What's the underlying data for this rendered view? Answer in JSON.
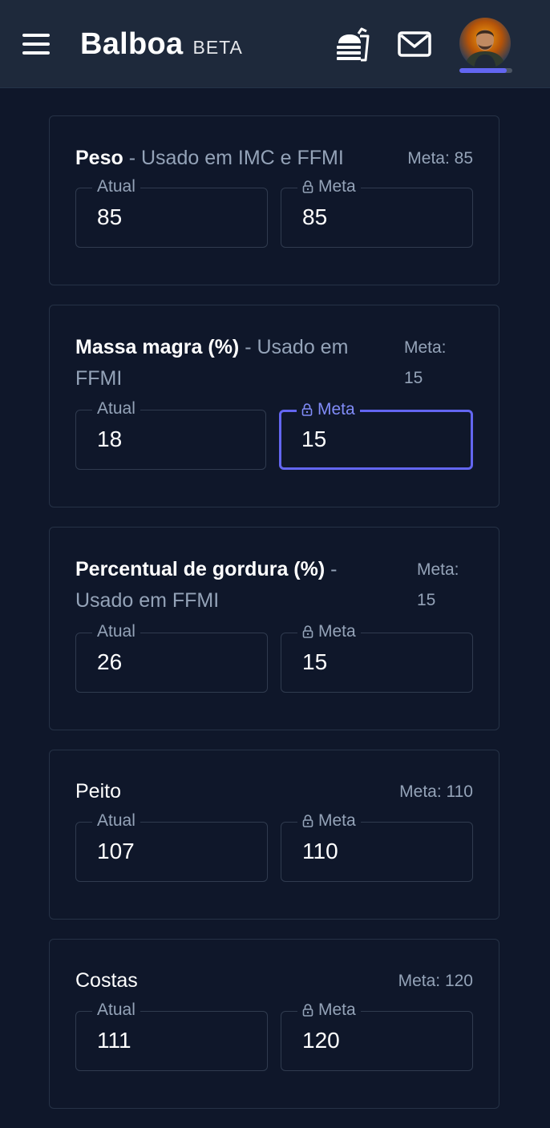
{
  "header": {
    "brand": "Balboa",
    "badge": "BETA",
    "menu_icon": "hamburger-menu-icon",
    "food_icon": "food-tray-icon",
    "mail_icon": "mail-icon",
    "avatar_icon": "user-avatar",
    "profile_progress": 0.9
  },
  "colors": {
    "background": "#0f172a",
    "topbar": "#1e293b",
    "accent": "#6366f1",
    "muted_text": "#94a3b8",
    "border": "#303b4f"
  },
  "cards": [
    {
      "title": "Peso",
      "subtitle": " - Usado em IMC e FFMI",
      "title_bold": true,
      "meta": "Meta: 85",
      "current_label": "Atual",
      "current_value": "85",
      "target_label": "Meta",
      "target_value": "85",
      "target_focused": false
    },
    {
      "title": "Massa magra (%)",
      "subtitle": " - Usado em FFMI",
      "title_bold": true,
      "meta": "Meta: 15",
      "current_label": "Atual",
      "current_value": "18",
      "target_label": "Meta",
      "target_value": "15",
      "target_focused": true
    },
    {
      "title": "Percentual de gordura (%)",
      "subtitle": " - Usado em FFMI",
      "title_bold": true,
      "meta": "Meta: 15",
      "current_label": "Atual",
      "current_value": "26",
      "target_label": "Meta",
      "target_value": "15",
      "target_focused": false
    },
    {
      "title": "Peito",
      "subtitle": "",
      "title_bold": false,
      "meta": "Meta: 110",
      "current_label": "Atual",
      "current_value": "107",
      "target_label": "Meta",
      "target_value": "110",
      "target_focused": false
    },
    {
      "title": "Costas",
      "subtitle": "",
      "title_bold": false,
      "meta": "Meta: 120",
      "current_label": "Atual",
      "current_value": "111",
      "target_label": "Meta",
      "target_value": "120",
      "target_focused": false
    }
  ]
}
